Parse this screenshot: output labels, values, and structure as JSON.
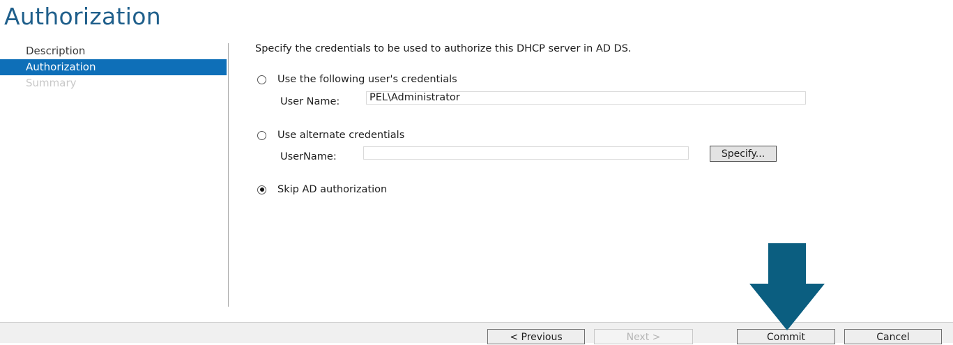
{
  "page": {
    "title": "Authorization"
  },
  "nav": {
    "items": [
      {
        "label": "Description",
        "state": "normal"
      },
      {
        "label": "Authorization",
        "state": "active"
      },
      {
        "label": "Summary",
        "state": "disabled"
      }
    ]
  },
  "content": {
    "intro": "Specify the credentials to be used to authorize this DHCP server in AD DS.",
    "option_user_credentials": {
      "label": "Use the following user's credentials",
      "checked": false,
      "field_label": "User Name:",
      "field_value": "PEL\\Administrator"
    },
    "option_alternate": {
      "label": "Use alternate credentials",
      "checked": false,
      "field_label": "UserName:",
      "field_value": "",
      "specify_label": "Specify..."
    },
    "option_skip": {
      "label": "Skip AD authorization",
      "checked": true
    }
  },
  "footer": {
    "previous_label": "< Previous",
    "next_label": "Next >",
    "commit_label": "Commit",
    "cancel_label": "Cancel"
  },
  "colors": {
    "accent": "#0e6fb8",
    "title": "#1f5f8b",
    "annotation_arrow": "#0b5e80"
  }
}
